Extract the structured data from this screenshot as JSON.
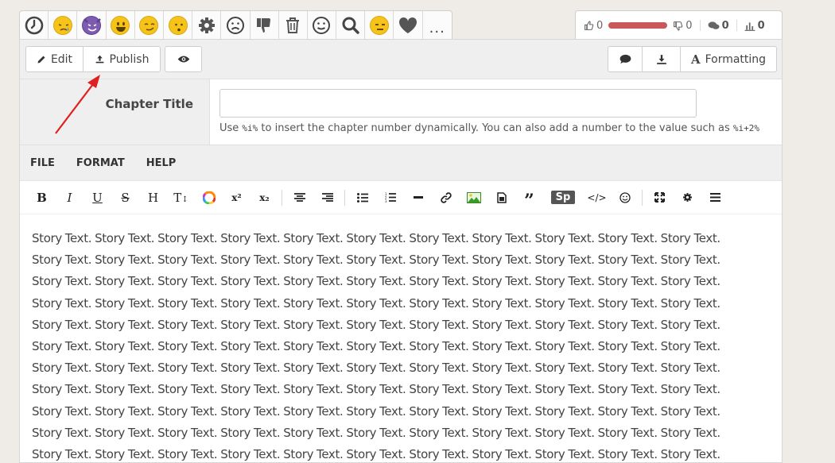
{
  "emojis": [
    "clock-icon",
    "sleepy-face-icon",
    "smiling-devil-icon",
    "grinning-face-icon",
    "smirking-face-icon",
    "hushed-face-icon",
    "gear-icon",
    "frowning-face-icon",
    "thumbs-down-icon",
    "trash-icon",
    "neutral-face-icon",
    "search-icon",
    "expressionless-face-icon",
    "heart-icon",
    "more-icon"
  ],
  "more_label": "...",
  "stats": {
    "likes": "0",
    "dislikes": "0",
    "comments": "0",
    "views": "0"
  },
  "toolbar_top": {
    "edit": "Edit",
    "publish": "Publish",
    "formatting": "Formatting"
  },
  "chapter": {
    "label": "Chapter Title",
    "value": "",
    "hint_prefix": "Use ",
    "hint_code1": "%i%",
    "hint_middle": " to insert the chapter number dynamically. You can also add a number to the value such as ",
    "hint_code2": "%i+2%"
  },
  "menu": {
    "file": "FILE",
    "format": "FORMAT",
    "help": "HELP"
  },
  "editor_toolbar": {
    "sp": "Sp"
  },
  "story_lines": [
    "Story Text. Story Text. Story Text. Story Text. Story Text. Story Text. Story Text. Story Text. Story Text. Story Text. Story Text.",
    "Story Text. Story Text. Story Text. Story Text. Story Text. Story Text. Story Text. Story Text. Story Text. Story Text. Story Text.",
    "Story Text. Story Text. Story Text. Story Text. Story Text. Story Text. Story Text. Story Text. Story Text. Story Text. Story Text.",
    "Story Text. Story Text. Story Text. Story Text. Story Text. Story Text. Story Text. Story Text. Story Text. Story Text. Story Text.",
    "Story Text. Story Text. Story Text. Story Text. Story Text. Story Text. Story Text. Story Text. Story Text. Story Text. Story Text.",
    "Story Text. Story Text. Story Text. Story Text. Story Text. Story Text. Story Text. Story Text. Story Text. Story Text. Story Text.",
    "Story Text. Story Text. Story Text. Story Text. Story Text. Story Text. Story Text. Story Text. Story Text. Story Text. Story Text.",
    "Story Text. Story Text. Story Text. Story Text. Story Text. Story Text. Story Text. Story Text. Story Text. Story Text. Story Text.",
    "Story Text. Story Text. Story Text. Story Text. Story Text. Story Text. Story Text. Story Text. Story Text. Story Text. Story Text.",
    "Story Text. Story Text. Story Text. Story Text. Story Text. Story Text. Story Text. Story Text. Story Text. Story Text. Story Text.",
    "Story Text. Story Text. Story Text. Story Text. Story Text. Story Text. Story Text. Story Text. Story Text. Story Text. Story Text."
  ],
  "colors": {
    "accent_red": "#e02020",
    "rating_bar": "#c9585a",
    "emoji_yellow": "#f6c31a",
    "emoji_purple": "#7d5bb0"
  }
}
